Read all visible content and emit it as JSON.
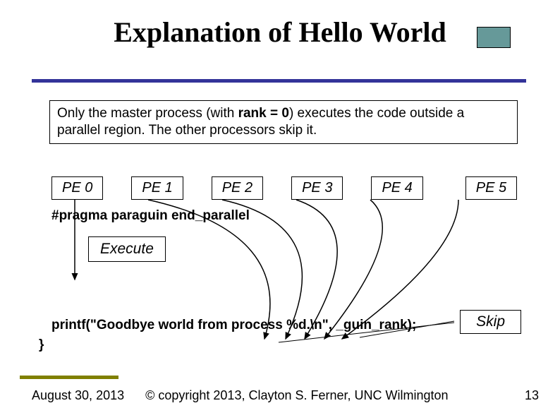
{
  "title": "Explanation of Hello World",
  "info_text_1": "Only the master process (with ",
  "info_rank": "rank = 0",
  "info_text_2": ") executes the code outside a parallel region. The other processors skip it.",
  "pe": [
    "PE 0",
    "PE 1",
    "PE 2",
    "PE 3",
    "PE 4",
    "PE 5"
  ],
  "pragma": "#pragma paraguin end_parallel",
  "execute": "Execute",
  "printf": "printf(\"Goodbye world from process %d.\\n\", _guin_rank);",
  "close_brace": "}",
  "skip": "Skip",
  "footer": {
    "date": "August 30, 2013",
    "copyright": "© copyright 2013, Clayton S. Ferner, UNC Wilmington",
    "page": "13"
  }
}
